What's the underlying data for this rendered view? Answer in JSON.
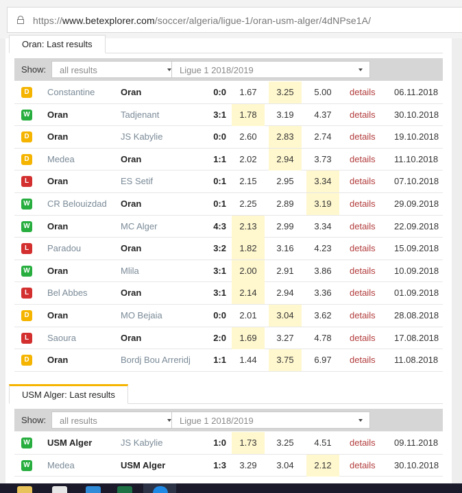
{
  "browser": {
    "url_prefix": "https://",
    "url_host": "www.betexplorer.com",
    "url_path": "/soccer/algeria/ligue-1/oran-usm-alger/4dNPse1A/"
  },
  "section1": {
    "tab": "Oran: Last results",
    "show_label": "Show:",
    "filter_value": "all results",
    "season_value": "Ligue 1 2018/2019",
    "rows": [
      {
        "res": "D",
        "home": "Constantine",
        "away": "Oran",
        "hb": false,
        "ab": true,
        "score": "0:0",
        "o1": "1.67",
        "ox": "3.25",
        "o2": "5.00",
        "hl": "x",
        "det": "details",
        "date": "06.11.2018"
      },
      {
        "res": "W",
        "home": "Oran",
        "away": "Tadjenant",
        "hb": true,
        "ab": false,
        "score": "3:1",
        "o1": "1.78",
        "ox": "3.19",
        "o2": "4.37",
        "hl": "1",
        "det": "details",
        "date": "30.10.2018"
      },
      {
        "res": "D",
        "home": "Oran",
        "away": "JS Kabylie",
        "hb": true,
        "ab": false,
        "score": "0:0",
        "o1": "2.60",
        "ox": "2.83",
        "o2": "2.74",
        "hl": "x",
        "det": "details",
        "date": "19.10.2018"
      },
      {
        "res": "D",
        "home": "Medea",
        "away": "Oran",
        "hb": false,
        "ab": true,
        "score": "1:1",
        "o1": "2.02",
        "ox": "2.94",
        "o2": "3.73",
        "hl": "x",
        "det": "details",
        "date": "11.10.2018"
      },
      {
        "res": "L",
        "home": "Oran",
        "away": "ES Setif",
        "hb": true,
        "ab": false,
        "score": "0:1",
        "o1": "2.15",
        "ox": "2.95",
        "o2": "3.34",
        "hl": "2",
        "det": "details",
        "date": "07.10.2018"
      },
      {
        "res": "W",
        "home": "CR Belouizdad",
        "away": "Oran",
        "hb": false,
        "ab": true,
        "score": "0:1",
        "o1": "2.25",
        "ox": "2.89",
        "o2": "3.19",
        "hl": "2",
        "det": "details",
        "date": "29.09.2018"
      },
      {
        "res": "W",
        "home": "Oran",
        "away": "MC Alger",
        "hb": true,
        "ab": false,
        "score": "4:3",
        "o1": "2.13",
        "ox": "2.99",
        "o2": "3.34",
        "hl": "1",
        "det": "details",
        "date": "22.09.2018"
      },
      {
        "res": "L",
        "home": "Paradou",
        "away": "Oran",
        "hb": false,
        "ab": true,
        "score": "3:2",
        "o1": "1.82",
        "ox": "3.16",
        "o2": "4.23",
        "hl": "1",
        "det": "details",
        "date": "15.09.2018"
      },
      {
        "res": "W",
        "home": "Oran",
        "away": "Mlila",
        "hb": true,
        "ab": false,
        "score": "3:1",
        "o1": "2.00",
        "ox": "2.91",
        "o2": "3.86",
        "hl": "1",
        "det": "details",
        "date": "10.09.2018"
      },
      {
        "res": "L",
        "home": "Bel Abbes",
        "away": "Oran",
        "hb": false,
        "ab": true,
        "score": "3:1",
        "o1": "2.14",
        "ox": "2.94",
        "o2": "3.36",
        "hl": "1",
        "det": "details",
        "date": "01.09.2018"
      },
      {
        "res": "D",
        "home": "Oran",
        "away": "MO Bejaia",
        "hb": true,
        "ab": false,
        "score": "0:0",
        "o1": "2.01",
        "ox": "3.04",
        "o2": "3.62",
        "hl": "x",
        "det": "details",
        "date": "28.08.2018"
      },
      {
        "res": "L",
        "home": "Saoura",
        "away": "Oran",
        "hb": false,
        "ab": true,
        "score": "2:0",
        "o1": "1.69",
        "ox": "3.27",
        "o2": "4.78",
        "hl": "1",
        "det": "details",
        "date": "17.08.2018"
      },
      {
        "res": "D",
        "home": "Oran",
        "away": "Bordj Bou Arreridj",
        "hb": true,
        "ab": false,
        "score": "1:1",
        "o1": "1.44",
        "ox": "3.75",
        "o2": "6.97",
        "hl": "x",
        "det": "details",
        "date": "11.08.2018"
      }
    ]
  },
  "section2": {
    "tab": "USM Alger: Last results",
    "show_label": "Show:",
    "filter_value": "all results",
    "season_value": "Ligue 1 2018/2019",
    "rows": [
      {
        "res": "W",
        "home": "USM Alger",
        "away": "JS Kabylie",
        "hb": true,
        "ab": false,
        "score": "1:0",
        "o1": "1.73",
        "ox": "3.25",
        "o2": "4.51",
        "hl": "1",
        "det": "details",
        "date": "09.11.2018"
      },
      {
        "res": "W",
        "home": "Medea",
        "away": "USM Alger",
        "hb": false,
        "ab": true,
        "score": "1:3",
        "o1": "3.29",
        "ox": "3.04",
        "o2": "2.12",
        "hl": "2",
        "det": "details",
        "date": "30.10.2018"
      }
    ]
  },
  "colors": {
    "draw": "#f5b400",
    "win": "#27ae3f",
    "loss": "#d32f2f",
    "highlight": "#fff8cf",
    "details": "#b23a3a"
  }
}
